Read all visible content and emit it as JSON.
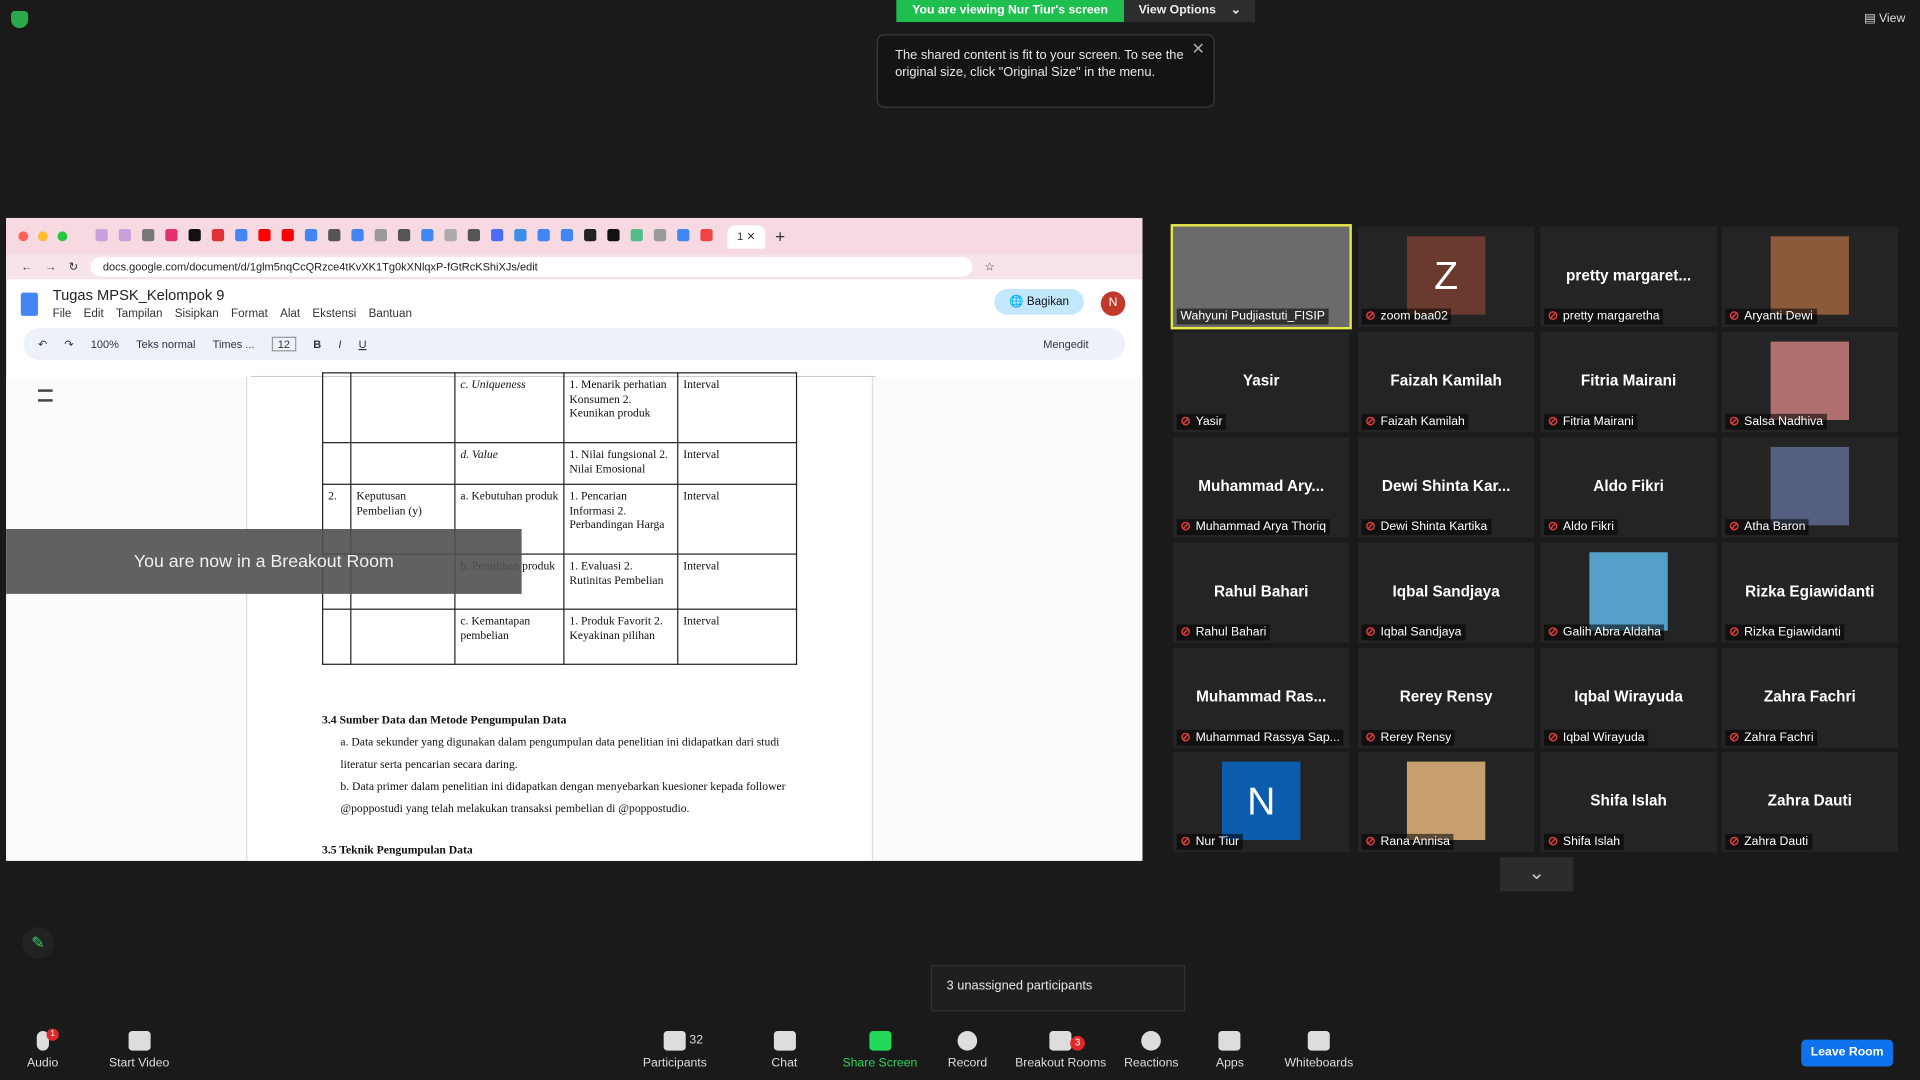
{
  "banner": {
    "viewing": "You are viewing Nur Tiur's screen",
    "view_options": "View Options"
  },
  "tooltip": "The shared content is fit to your screen. To see the original size, click \"Original Size\" in the menu.",
  "view_label": "View",
  "browser": {
    "url": "docs.google.com/document/d/1glm5nqCcQRzce4tKvXK1Tg0kXNlqxP-fGtRcKShiXJs/edit",
    "doc_title": "Tugas MPSK_Kelompok 9",
    "menus": [
      "File",
      "Edit",
      "Tampilan",
      "Sisipkan",
      "Format",
      "Alat",
      "Ekstensi",
      "Bantuan"
    ],
    "share_label": "Bagikan",
    "avatar_letter": "N",
    "zoom": "100%",
    "style": "Teks normal",
    "font": "Times ...",
    "font_size": "12",
    "mode": "Mengedit"
  },
  "table_rows": [
    {
      "no": "",
      "var": "",
      "dim": "c. Uniqueness",
      "ind": "1. Menarik perhatian Konsumen 2. Keunikan produk",
      "scale": "Interval"
    },
    {
      "no": "",
      "var": "",
      "dim": "d. Value",
      "ind": "1. Nilai fungsional 2. Nilai Emosional",
      "scale": "Interval"
    },
    {
      "no": "2.",
      "var": "Keputusan Pembelian (y)",
      "dim": "a. Kebutuhan produk",
      "ind": "1. Pencarian Informasi 2. Perbandingan Harga",
      "scale": "Interval"
    },
    {
      "no": "",
      "var": "",
      "dim": "b. Pemilihan produk",
      "ind": "1. Evaluasi 2. Rutinitas Pembelian",
      "scale": "Interval"
    },
    {
      "no": "",
      "var": "",
      "dim": "c. Kemantapan pembelian",
      "ind": "1. Produk Favorit 2. Keyakinan pilihan",
      "scale": "Interval"
    }
  ],
  "doc": {
    "section_34": "3.4 Sumber Data dan Metode Pengumpulan Data",
    "item_a": "a.  Data sekunder yang digunakan dalam pengumpulan data penelitian ini didapatkan dari studi literatur serta pencarian secara daring.",
    "item_b": "b.  Data primer dalam penelitian ini didapatkan dengan menyebarkan kuesioner kepada follower @poppostudi yang telah melakukan transaksi pembelian di @poppostudio.",
    "section_35": "3.5 Teknik Pengumpulan Data"
  },
  "breakout_notice": "You are now in a Breakout Room",
  "participants": [
    {
      "label": "Wahyuni Pudjiastuti_FISIP",
      "name": "",
      "type": "video"
    },
    {
      "label": "zoom baa02",
      "name": "Z",
      "type": "avatar",
      "color": "#6b3a2f"
    },
    {
      "label": "pretty margaretha",
      "name": "pretty margaret...",
      "type": "name"
    },
    {
      "label": "Aryanti Dewi",
      "name": "",
      "type": "photo"
    },
    {
      "label": "Yasir",
      "name": "Yasir",
      "type": "name"
    },
    {
      "label": "Faizah Kamilah",
      "name": "Faizah Kamilah",
      "type": "name"
    },
    {
      "label": "Fitria Mairani",
      "name": "Fitria Mairani",
      "type": "name"
    },
    {
      "label": "Salsa Nadhiva",
      "name": "",
      "type": "photo"
    },
    {
      "label": "Muhammad Arya Thoriq",
      "name": "Muhammad Ary...",
      "type": "name"
    },
    {
      "label": "Dewi Shinta Kartika",
      "name": "Dewi Shinta Kar...",
      "type": "name"
    },
    {
      "label": "Aldo Fikri",
      "name": "Aldo Fikri",
      "type": "name"
    },
    {
      "label": "Atha Baron",
      "name": "",
      "type": "photo"
    },
    {
      "label": "Rahul Bahari",
      "name": "Rahul Bahari",
      "type": "name"
    },
    {
      "label": "Iqbal Sandjaya",
      "name": "Iqbal Sandjaya",
      "type": "name"
    },
    {
      "label": "Galih Abra Aldaha",
      "name": "",
      "type": "photo"
    },
    {
      "label": "Rizka Egiawidanti",
      "name": "Rizka Egiawidanti",
      "type": "name"
    },
    {
      "label": "Muhammad Rassya Sap...",
      "name": "Muhammad Ras...",
      "type": "name"
    },
    {
      "label": "Rerey Rensy",
      "name": "Rerey Rensy",
      "type": "name"
    },
    {
      "label": "Iqbal Wirayuda",
      "name": "Iqbal Wirayuda",
      "type": "name"
    },
    {
      "label": "Zahra Fachri",
      "name": "Zahra Fachri",
      "type": "name"
    },
    {
      "label": "Nur Tiur",
      "name": "N",
      "type": "avatar",
      "color": "#0b5cad"
    },
    {
      "label": "Rana Annisa",
      "name": "",
      "type": "photo"
    },
    {
      "label": "Shifa Islah",
      "name": "Shifa Islah",
      "type": "name"
    },
    {
      "label": "Zahra Dauti",
      "name": "Zahra Dauti",
      "type": "name"
    }
  ],
  "unassigned": "3 unassigned participants",
  "toolbar": {
    "audio": "Audio",
    "start_video": "Start Video",
    "participants": "Participants",
    "participants_count": "32",
    "chat": "Chat",
    "share": "Share Screen",
    "record": "Record",
    "breakout": "Breakout Rooms",
    "breakout_badge": "3",
    "reactions": "Reactions",
    "apps": "Apps",
    "whiteboards": "Whiteboards",
    "leave": "Leave Room",
    "audio_badge": "1"
  },
  "colors": {
    "share_green": "#23d959",
    "leave_blue": "#0e72ed",
    "active_speaker": "#e5e84b"
  }
}
